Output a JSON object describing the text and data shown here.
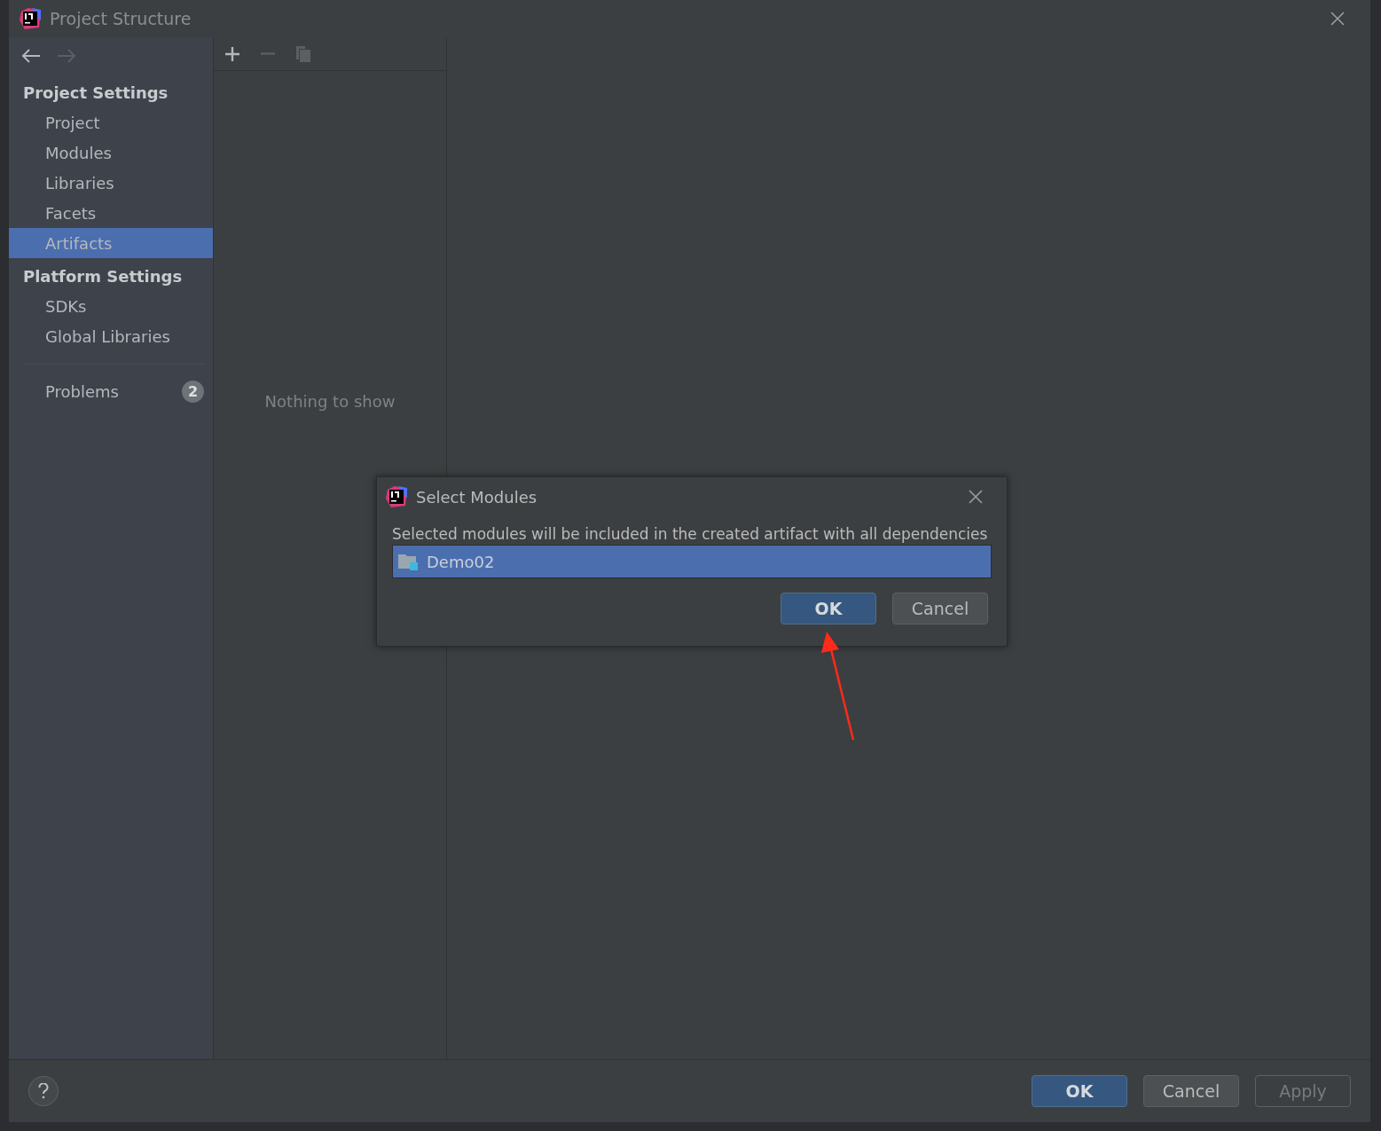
{
  "window": {
    "title": "Project Structure"
  },
  "sidebar": {
    "sections": [
      {
        "title": "Project Settings",
        "items": [
          {
            "label": "Project",
            "selected": false
          },
          {
            "label": "Modules",
            "selected": false
          },
          {
            "label": "Libraries",
            "selected": false
          },
          {
            "label": "Facets",
            "selected": false
          },
          {
            "label": "Artifacts",
            "selected": true
          }
        ]
      },
      {
        "title": "Platform Settings",
        "items": [
          {
            "label": "SDKs",
            "selected": false
          },
          {
            "label": "Global Libraries",
            "selected": false
          }
        ]
      }
    ],
    "problems": {
      "label": "Problems",
      "count": "2"
    }
  },
  "toolbar": {
    "add_disabled": false,
    "remove_disabled": true,
    "copy_disabled": true
  },
  "artifacts_list": {
    "empty_text": "Nothing to show"
  },
  "dialog": {
    "title": "Select Modules",
    "message": "Selected modules will be included in the created artifact with all dependencies",
    "modules": [
      {
        "name": "Demo02",
        "selected": true
      }
    ],
    "buttons": [
      {
        "label": "OK",
        "kind": "default"
      },
      {
        "label": "Cancel",
        "kind": "normal"
      }
    ]
  },
  "footer": {
    "buttons": [
      {
        "label": "OK",
        "kind": "default"
      },
      {
        "label": "Cancel",
        "kind": "normal"
      },
      {
        "label": "Apply",
        "kind": "disabled"
      }
    ]
  }
}
